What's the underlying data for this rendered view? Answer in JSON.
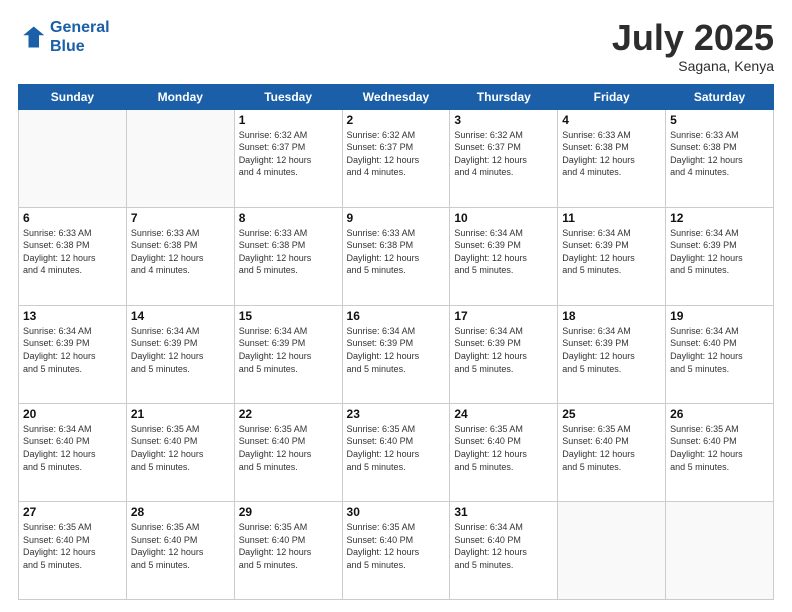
{
  "logo": {
    "line1": "General",
    "line2": "Blue"
  },
  "title": "July 2025",
  "subtitle": "Sagana, Kenya",
  "days_of_week": [
    "Sunday",
    "Monday",
    "Tuesday",
    "Wednesday",
    "Thursday",
    "Friday",
    "Saturday"
  ],
  "weeks": [
    [
      {
        "day": "",
        "info": ""
      },
      {
        "day": "",
        "info": ""
      },
      {
        "day": "1",
        "info": "Sunrise: 6:32 AM\nSunset: 6:37 PM\nDaylight: 12 hours\nand 4 minutes."
      },
      {
        "day": "2",
        "info": "Sunrise: 6:32 AM\nSunset: 6:37 PM\nDaylight: 12 hours\nand 4 minutes."
      },
      {
        "day": "3",
        "info": "Sunrise: 6:32 AM\nSunset: 6:37 PM\nDaylight: 12 hours\nand 4 minutes."
      },
      {
        "day": "4",
        "info": "Sunrise: 6:33 AM\nSunset: 6:38 PM\nDaylight: 12 hours\nand 4 minutes."
      },
      {
        "day": "5",
        "info": "Sunrise: 6:33 AM\nSunset: 6:38 PM\nDaylight: 12 hours\nand 4 minutes."
      }
    ],
    [
      {
        "day": "6",
        "info": "Sunrise: 6:33 AM\nSunset: 6:38 PM\nDaylight: 12 hours\nand 4 minutes."
      },
      {
        "day": "7",
        "info": "Sunrise: 6:33 AM\nSunset: 6:38 PM\nDaylight: 12 hours\nand 4 minutes."
      },
      {
        "day": "8",
        "info": "Sunrise: 6:33 AM\nSunset: 6:38 PM\nDaylight: 12 hours\nand 5 minutes."
      },
      {
        "day": "9",
        "info": "Sunrise: 6:33 AM\nSunset: 6:38 PM\nDaylight: 12 hours\nand 5 minutes."
      },
      {
        "day": "10",
        "info": "Sunrise: 6:34 AM\nSunset: 6:39 PM\nDaylight: 12 hours\nand 5 minutes."
      },
      {
        "day": "11",
        "info": "Sunrise: 6:34 AM\nSunset: 6:39 PM\nDaylight: 12 hours\nand 5 minutes."
      },
      {
        "day": "12",
        "info": "Sunrise: 6:34 AM\nSunset: 6:39 PM\nDaylight: 12 hours\nand 5 minutes."
      }
    ],
    [
      {
        "day": "13",
        "info": "Sunrise: 6:34 AM\nSunset: 6:39 PM\nDaylight: 12 hours\nand 5 minutes."
      },
      {
        "day": "14",
        "info": "Sunrise: 6:34 AM\nSunset: 6:39 PM\nDaylight: 12 hours\nand 5 minutes."
      },
      {
        "day": "15",
        "info": "Sunrise: 6:34 AM\nSunset: 6:39 PM\nDaylight: 12 hours\nand 5 minutes."
      },
      {
        "day": "16",
        "info": "Sunrise: 6:34 AM\nSunset: 6:39 PM\nDaylight: 12 hours\nand 5 minutes."
      },
      {
        "day": "17",
        "info": "Sunrise: 6:34 AM\nSunset: 6:39 PM\nDaylight: 12 hours\nand 5 minutes."
      },
      {
        "day": "18",
        "info": "Sunrise: 6:34 AM\nSunset: 6:39 PM\nDaylight: 12 hours\nand 5 minutes."
      },
      {
        "day": "19",
        "info": "Sunrise: 6:34 AM\nSunset: 6:40 PM\nDaylight: 12 hours\nand 5 minutes."
      }
    ],
    [
      {
        "day": "20",
        "info": "Sunrise: 6:34 AM\nSunset: 6:40 PM\nDaylight: 12 hours\nand 5 minutes."
      },
      {
        "day": "21",
        "info": "Sunrise: 6:35 AM\nSunset: 6:40 PM\nDaylight: 12 hours\nand 5 minutes."
      },
      {
        "day": "22",
        "info": "Sunrise: 6:35 AM\nSunset: 6:40 PM\nDaylight: 12 hours\nand 5 minutes."
      },
      {
        "day": "23",
        "info": "Sunrise: 6:35 AM\nSunset: 6:40 PM\nDaylight: 12 hours\nand 5 minutes."
      },
      {
        "day": "24",
        "info": "Sunrise: 6:35 AM\nSunset: 6:40 PM\nDaylight: 12 hours\nand 5 minutes."
      },
      {
        "day": "25",
        "info": "Sunrise: 6:35 AM\nSunset: 6:40 PM\nDaylight: 12 hours\nand 5 minutes."
      },
      {
        "day": "26",
        "info": "Sunrise: 6:35 AM\nSunset: 6:40 PM\nDaylight: 12 hours\nand 5 minutes."
      }
    ],
    [
      {
        "day": "27",
        "info": "Sunrise: 6:35 AM\nSunset: 6:40 PM\nDaylight: 12 hours\nand 5 minutes."
      },
      {
        "day": "28",
        "info": "Sunrise: 6:35 AM\nSunset: 6:40 PM\nDaylight: 12 hours\nand 5 minutes."
      },
      {
        "day": "29",
        "info": "Sunrise: 6:35 AM\nSunset: 6:40 PM\nDaylight: 12 hours\nand 5 minutes."
      },
      {
        "day": "30",
        "info": "Sunrise: 6:35 AM\nSunset: 6:40 PM\nDaylight: 12 hours\nand 5 minutes."
      },
      {
        "day": "31",
        "info": "Sunrise: 6:34 AM\nSunset: 6:40 PM\nDaylight: 12 hours\nand 5 minutes."
      },
      {
        "day": "",
        "info": ""
      },
      {
        "day": "",
        "info": ""
      }
    ]
  ]
}
